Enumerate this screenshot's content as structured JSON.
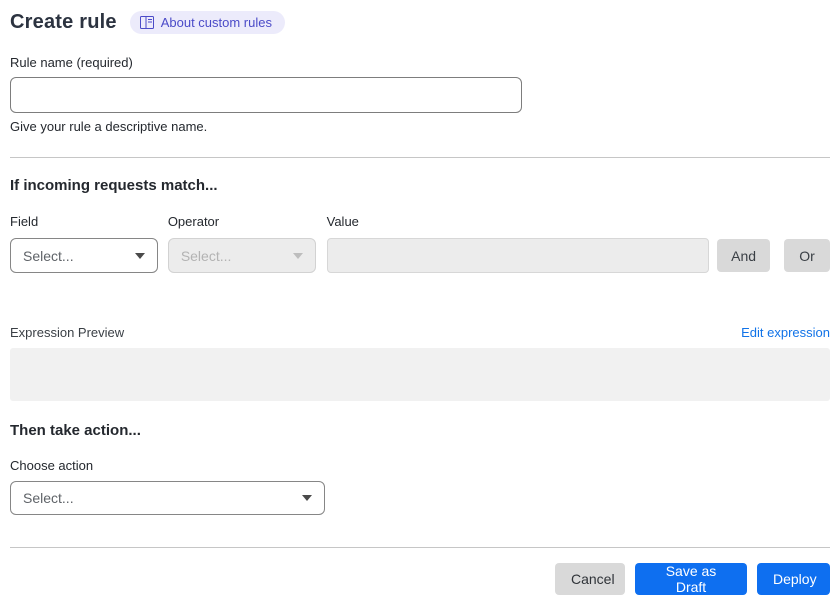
{
  "header": {
    "title": "Create rule",
    "badge_label": "About custom rules"
  },
  "rule_name": {
    "label": "Rule name (required)",
    "value": "",
    "helper": "Give your rule a descriptive name."
  },
  "match": {
    "heading": "If incoming requests match...",
    "field": {
      "label": "Field",
      "selected_value": "Select..."
    },
    "operator": {
      "label": "Operator",
      "selected_value": "Select...",
      "disabled": true
    },
    "value": {
      "label": "Value",
      "value": "",
      "disabled": true
    },
    "and_button": "And",
    "or_button": "Or"
  },
  "expression": {
    "label": "Expression Preview",
    "edit_link": "Edit expression",
    "content": ""
  },
  "action": {
    "heading": "Then take action...",
    "label": "Choose action",
    "selected_value": "Select..."
  },
  "footer": {
    "cancel": "Cancel",
    "save_draft": "Save as Draft",
    "deploy": "Deploy"
  },
  "icons": {
    "badge_icon": "book-icon",
    "dropdown_icon": "chevron-down-icon"
  },
  "colors": {
    "primary_blue": "#0E6FF0",
    "link_blue": "#1173E8",
    "badge_bg": "#ECEBFB",
    "badge_text": "#4B4BC8",
    "neutral_button_bg": "#D9D9D9",
    "disabled_bg": "#ECECEC",
    "preview_bg": "#F1F1F1"
  }
}
